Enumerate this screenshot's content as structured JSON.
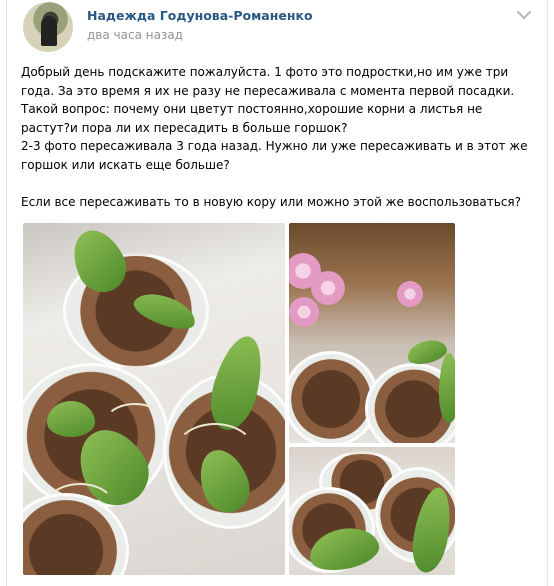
{
  "post": {
    "author": "Надежда Годунова-Романенко",
    "time": "два часа назад",
    "text": "Добрый день подскажите пожалуйста. 1 фото это подростки,но им уже три года. За это время я их не разу не пересаживала с момента первой посадки. Такой вопрос: почему они цветут постоянно,хорошие корни а листья не растут?и пора ли их пересадить в больше горшок?\n2-3 фото пересаживала 3 года назад. Нужно ли уже пересаживать и в этот же горшок или искать еще больше?\n\nЕсли все пересаживать то в новую кору или можно этой же воспользоваться?"
  },
  "icons": {
    "menu": "chevron-down-icon",
    "avatar": "user-avatar"
  },
  "colors": {
    "author_link": "#2a5885",
    "meta_text": "#939393",
    "border": "#e1e3e6"
  }
}
